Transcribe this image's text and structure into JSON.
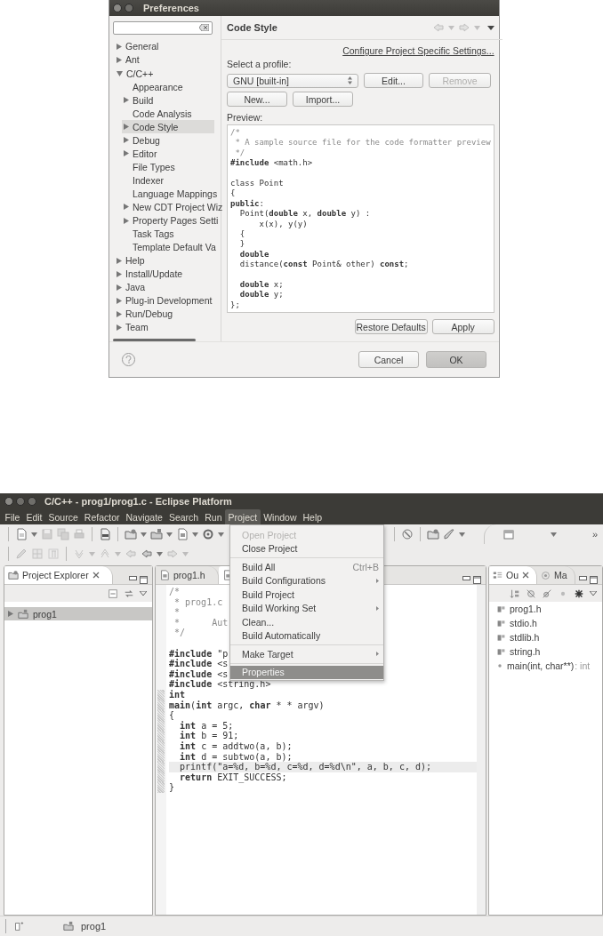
{
  "preferences": {
    "title": "Preferences",
    "tree": [
      {
        "label": "General",
        "kind": "folder",
        "expanded": false,
        "selected": false
      },
      {
        "label": "Ant",
        "kind": "folder",
        "expanded": false,
        "selected": false
      },
      {
        "label": "C/C++",
        "kind": "folder",
        "expanded": true,
        "selected": false,
        "children": [
          {
            "label": "Appearance",
            "kind": "leaf",
            "selected": false
          },
          {
            "label": "Build",
            "kind": "folder",
            "expanded": false,
            "selected": false
          },
          {
            "label": "Code Analysis",
            "kind": "leaf",
            "selected": false
          },
          {
            "label": "Code Style",
            "kind": "folder",
            "expanded": false,
            "selected": true
          },
          {
            "label": "Debug",
            "kind": "folder",
            "expanded": false,
            "selected": false
          },
          {
            "label": "Editor",
            "kind": "folder",
            "expanded": false,
            "selected": false
          },
          {
            "label": "File Types",
            "kind": "leaf",
            "selected": false
          },
          {
            "label": "Indexer",
            "kind": "leaf",
            "selected": false
          },
          {
            "label": "Language Mappings",
            "kind": "leaf",
            "selected": false
          },
          {
            "label": "New CDT Project Wiz",
            "kind": "folder",
            "expanded": false,
            "selected": false
          },
          {
            "label": "Property Pages Setti",
            "kind": "folder",
            "expanded": false,
            "selected": false
          },
          {
            "label": "Task Tags",
            "kind": "leaf",
            "selected": false
          },
          {
            "label": "Template Default Va",
            "kind": "leaf",
            "selected": false
          }
        ]
      },
      {
        "label": "Help",
        "kind": "folder",
        "expanded": false,
        "selected": false
      },
      {
        "label": "Install/Update",
        "kind": "folder",
        "expanded": false,
        "selected": false
      },
      {
        "label": "Java",
        "kind": "folder",
        "expanded": false,
        "selected": false
      },
      {
        "label": "Plug-in Development",
        "kind": "folder",
        "expanded": false,
        "selected": false
      },
      {
        "label": "Run/Debug",
        "kind": "folder",
        "expanded": false,
        "selected": false
      },
      {
        "label": "Team",
        "kind": "folder",
        "expanded": false,
        "selected": false
      }
    ],
    "page_title": "Code Style",
    "link": "Configure Project Specific Settings...",
    "profile_label": "Select a profile:",
    "profile": "GNU [built-in]",
    "profile_buttons": [
      {
        "label": "Edit...",
        "disabled": false
      },
      {
        "label": "Remove",
        "disabled": true
      }
    ],
    "profile_actions": [
      {
        "label": "New...",
        "disabled": false
      },
      {
        "label": "Import...",
        "disabled": false
      }
    ],
    "preview_label": "Preview:",
    "preview": [
      {
        "kind": "comment",
        "text": "/*"
      },
      {
        "kind": "comment",
        "text": " * A sample source file for the code formatter preview"
      },
      {
        "kind": "comment",
        "text": " */"
      },
      {
        "kind": "code",
        "text": "**#include** <math.h>"
      },
      {
        "kind": "blank"
      },
      {
        "kind": "code",
        "text": "class Point"
      },
      {
        "kind": "code",
        "text": "{"
      },
      {
        "kind": "code",
        "text": "**public**:"
      },
      {
        "kind": "code",
        "text": "  Point(**double** x, **double** y) :"
      },
      {
        "kind": "code",
        "text": "      x(x), y(y)"
      },
      {
        "kind": "code",
        "text": "  {"
      },
      {
        "kind": "code",
        "text": "  }"
      },
      {
        "kind": "code",
        "text": "  **double**"
      },
      {
        "kind": "code",
        "text": "  distance(**const** Point& other) **const**;"
      },
      {
        "kind": "blank"
      },
      {
        "kind": "code",
        "text": "  **double** x;"
      },
      {
        "kind": "code",
        "text": "  **double** y;"
      },
      {
        "kind": "code",
        "text": "};"
      }
    ],
    "page_buttons": [
      "Restore Defaults",
      "Apply"
    ],
    "dialog_buttons": [
      {
        "label": "Cancel",
        "default": false
      },
      {
        "label": "OK",
        "default": true
      }
    ]
  },
  "eclipse": {
    "title": "C/C++ - prog1/prog1.c - Eclipse Platform",
    "menu": [
      {
        "label": "File",
        "selected": false
      },
      {
        "label": "Edit",
        "selected": false
      },
      {
        "label": "Source",
        "selected": false
      },
      {
        "label": "Refactor",
        "selected": false
      },
      {
        "label": "Navigate",
        "selected": false
      },
      {
        "label": "Search",
        "selected": false
      },
      {
        "label": "Run",
        "selected": false
      },
      {
        "label": "Project",
        "selected": true
      },
      {
        "label": "Window",
        "selected": false
      },
      {
        "label": "Help",
        "selected": false
      }
    ],
    "project_menu": [
      {
        "kind": "item",
        "label": "Open Project",
        "disabled": true,
        "submenu": false,
        "selected": false
      },
      {
        "kind": "item",
        "label": "Close Project",
        "disabled": false,
        "submenu": false,
        "selected": false
      },
      {
        "kind": "separator"
      },
      {
        "kind": "item",
        "label": "Build All",
        "shortcut": "Ctrl+B",
        "disabled": false,
        "submenu": false,
        "selected": false
      },
      {
        "kind": "item",
        "label": "Build Configurations",
        "disabled": false,
        "submenu": true,
        "selected": false
      },
      {
        "kind": "item",
        "label": "Build Project",
        "disabled": false,
        "submenu": false,
        "selected": false
      },
      {
        "kind": "item",
        "label": "Build Working Set",
        "disabled": false,
        "submenu": true,
        "selected": false
      },
      {
        "kind": "item",
        "label": "Clean...",
        "disabled": false,
        "submenu": false,
        "selected": false
      },
      {
        "kind": "item",
        "label": "Build Automatically",
        "disabled": false,
        "submenu": false,
        "selected": false
      },
      {
        "kind": "separator"
      },
      {
        "kind": "item",
        "label": "Make Target",
        "disabled": false,
        "submenu": true,
        "selected": false
      },
      {
        "kind": "separator"
      },
      {
        "kind": "item",
        "label": "Properties",
        "disabled": false,
        "submenu": false,
        "selected": true
      }
    ],
    "toolbar_overflow": "»",
    "explorer": {
      "tab": "Project Explorer",
      "tree": [
        {
          "label": "prog1",
          "kind": "folder",
          "expanded": false,
          "selected": true
        }
      ]
    },
    "editor": {
      "tabs": [
        {
          "label": "prog1.h",
          "selected": false
        },
        {
          "selected": true
        }
      ],
      "lines": [
        {
          "kind": "comment",
          "text": "/*",
          "marked": false,
          "highlighted": false
        },
        {
          "kind": "comment",
          "text": " * prog1.c",
          "marked": false,
          "highlighted": false
        },
        {
          "kind": "comment",
          "text": " *",
          "marked": false,
          "highlighted": false
        },
        {
          "kind": "comment",
          "text": " *      Aut",
          "marked": false,
          "highlighted": false
        },
        {
          "kind": "comment",
          "text": " */",
          "marked": false,
          "highlighted": false
        },
        {
          "kind": "blank",
          "marked": false,
          "highlighted": false
        },
        {
          "kind": "code",
          "text": "**#include** \"p",
          "marked": false,
          "highlighted": false
        },
        {
          "kind": "code",
          "text": "**#include** <s",
          "marked": false,
          "highlighted": false
        },
        {
          "kind": "code",
          "text": "**#include** <s",
          "marked": false,
          "highlighted": false
        },
        {
          "kind": "code",
          "text": "**#include** <string.h>",
          "marked": false,
          "highlighted": false
        },
        {
          "kind": "code",
          "text": "**int**",
          "marked": true,
          "highlighted": false
        },
        {
          "kind": "code",
          "text": "**main**(**int** argc, **char** * * argv)",
          "marked": true,
          "highlighted": false
        },
        {
          "kind": "code",
          "text": "{",
          "marked": true,
          "highlighted": false
        },
        {
          "kind": "code",
          "text": "  **int** a = 5;",
          "marked": true,
          "highlighted": false
        },
        {
          "kind": "code",
          "text": "  **int** b = 91;",
          "marked": true,
          "highlighted": false
        },
        {
          "kind": "code",
          "text": "  **int** c = addtwo(a, b);",
          "marked": true,
          "highlighted": false
        },
        {
          "kind": "code",
          "text": "  **int** d = subtwo(a, b);",
          "marked": true,
          "highlighted": false
        },
        {
          "kind": "code",
          "text": "  printf(\"a=%d, b=%d, c=%d, d=%d\\n\", a, b, c, d);",
          "marked": true,
          "highlighted": true
        },
        {
          "kind": "code",
          "text": "  **return** EXIT_SUCCESS;",
          "marked": true,
          "highlighted": false
        },
        {
          "kind": "code",
          "text": "}",
          "marked": true,
          "highlighted": false
        }
      ]
    },
    "outline": {
      "tabs": [
        {
          "label": "Ou",
          "selected": true
        },
        {
          "label": "Ma",
          "selected": false
        }
      ],
      "items": [
        {
          "kind": "include",
          "name": "prog1.h"
        },
        {
          "kind": "include",
          "name": "stdio.h"
        },
        {
          "kind": "include",
          "name": "stdlib.h"
        },
        {
          "kind": "include",
          "name": "string.h"
        },
        {
          "kind": "function",
          "name": "main(int, char**)",
          "type": ": int"
        }
      ]
    },
    "status": {
      "project": "prog1"
    }
  }
}
